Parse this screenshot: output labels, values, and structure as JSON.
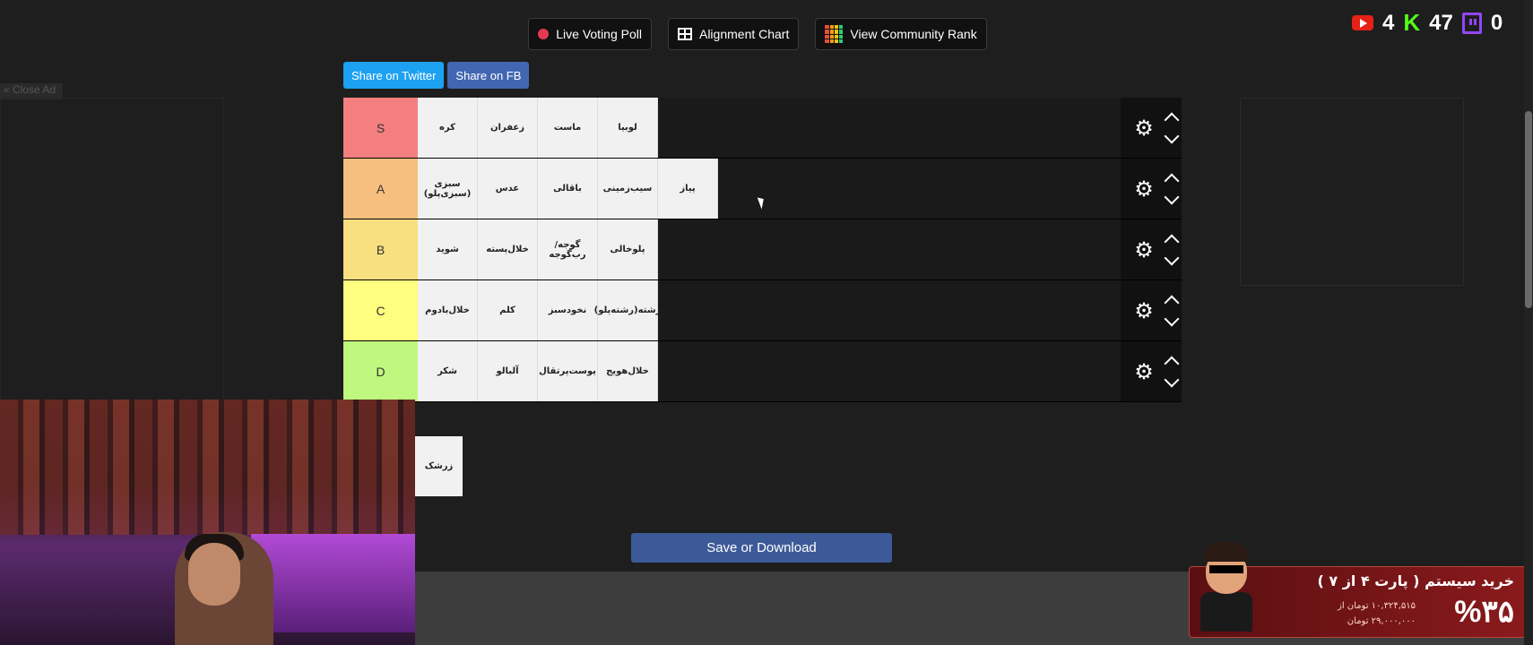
{
  "topbar": {
    "live_voting": "Live Voting Poll",
    "alignment_chart": "Alignment Chart",
    "community_rank": "View Community Rank"
  },
  "share": {
    "twitter": "Share on Twitter",
    "fb": "Share on FB"
  },
  "close_ad": "« Close Ad",
  "counters": {
    "youtube": "4",
    "kick": "47",
    "twitch": "0"
  },
  "tiers": [
    {
      "label": "S",
      "color": "#f37f7f",
      "items": [
        "کره",
        "زعفران",
        "ماست",
        "لوبیا"
      ]
    },
    {
      "label": "A",
      "color": "#f7bf7f",
      "items": [
        "سبزی (سبزی‌پلو)",
        "عدس",
        "باقالی",
        "سیب‌زمینی",
        "پیاز"
      ]
    },
    {
      "label": "B",
      "color": "#f8df7f",
      "items": [
        "شوید",
        "خلال‌پسته",
        "گوجه/رب‌گوجه",
        "پلوخالی"
      ]
    },
    {
      "label": "C",
      "color": "#fefe7f",
      "items": [
        "خلال‌بادوم",
        "کلم",
        "نخودسبز",
        "رشته(رشته‌پلو)"
      ]
    },
    {
      "label": "D",
      "color": "#bff77f",
      "items": [
        "شکر",
        "آلبالو",
        "پوست‌پرتقال",
        "خلال‌هویج"
      ]
    }
  ],
  "unsorted_item": "زرشک",
  "save_label": "Save or Download",
  "promo": {
    "title": "خرید سیستم ( پارت ۴ از ۷ )",
    "line1": "۱۰,۳۲۴,۵۱۵ تومان از",
    "line2": "۲۹,۰۰۰,۰۰۰ تومان",
    "percent": "%۳۵"
  }
}
